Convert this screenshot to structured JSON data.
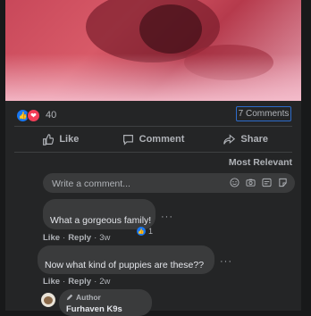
{
  "post": {
    "reaction_count": "40",
    "comments_link": "7 Comments"
  },
  "actions": {
    "like": "Like",
    "comment": "Comment",
    "share": "Share"
  },
  "sort_label": "Most Relevant",
  "write_comment_placeholder": "Write a comment...",
  "comments": [
    {
      "text": "What a gorgeous family!",
      "like_label": "Like",
      "reply_label": "Reply",
      "age": "3w",
      "reactions": "1"
    },
    {
      "text": "Now what kind of puppies are these??",
      "like_label": "Like",
      "reply_label": "Reply",
      "age": "2w"
    },
    {
      "badge": "Author",
      "name": "Furhaven K9s"
    }
  ],
  "colors": {
    "background": "#18191a",
    "card": "#242526",
    "bubble": "#3a3b3c",
    "accent": "#1877f2",
    "love": "#f33e58"
  }
}
